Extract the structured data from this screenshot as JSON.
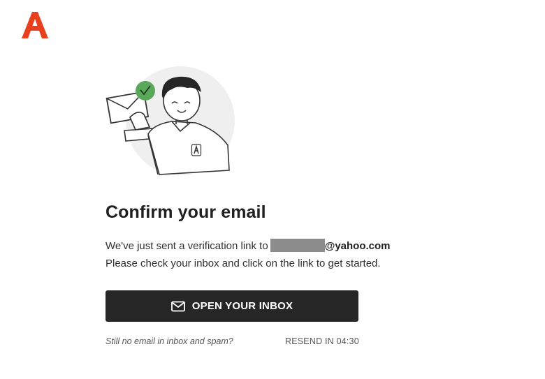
{
  "brand": {
    "logo_icon": "a-logo-icon",
    "accent_color": "#E8401C"
  },
  "illustration": {
    "icon": "person-holding-envelope-illustration",
    "check_color": "#4CAF50"
  },
  "title": "Confirm your email",
  "message": {
    "prefix": "We've just sent a verification link to",
    "email_domain": "@yahoo.com",
    "line2": "Please check your inbox and click on the link to get started."
  },
  "open_inbox_button": {
    "label": "OPEN YOUR INBOX",
    "icon": "mail-icon"
  },
  "footer": {
    "note": "Still no email in inbox and spam?",
    "resend_label": "RESEND IN",
    "resend_timer": "04:30"
  }
}
